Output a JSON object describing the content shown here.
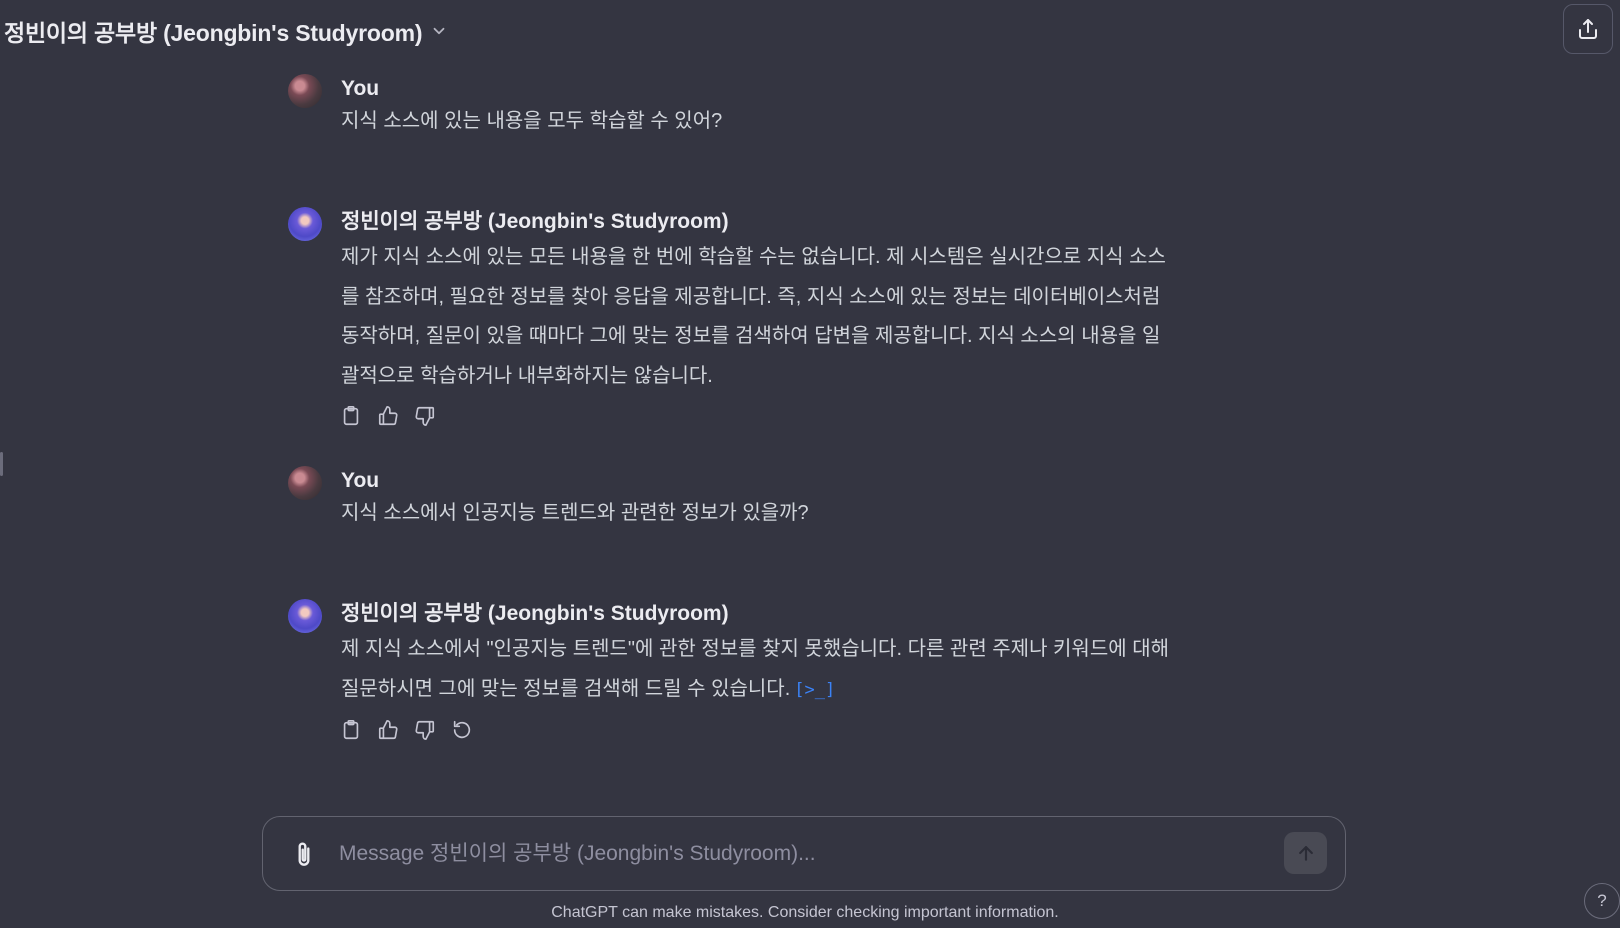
{
  "header": {
    "title": "정빈이의 공부방 (Jeongbin's Studyroom)",
    "dropdown_icon": "chevron-down-icon",
    "share_icon": "share-icon"
  },
  "messages": [
    {
      "author": "You",
      "role": "user",
      "text": "지식 소스에 있는 내용을 모두 학습할 수 있어?"
    },
    {
      "author": "정빈이의 공부방 (Jeongbin's Studyroom)",
      "role": "assistant",
      "lines": [
        "제가 지식 소스에 있는 모든 내용을 한 번에 학습할 수는 없습니다. 제 시스템은 실시간으로 지식 소스",
        "를 참조하며, 필요한 정보를 찾아 응답을 제공합니다. 즉, 지식 소스에 있는 정보는 데이터베이스처럼",
        "동작하며, 질문이 있을 때마다 그에 맞는 정보를 검색하여 답변을 제공합니다. 지식 소스의 내용을 일",
        "괄적으로 학습하거나 내부화하지는 않습니다."
      ]
    },
    {
      "author": "You",
      "role": "user",
      "text": "지식 소스에서 인공지능 트렌드와 관련한 정보가 있을까?"
    },
    {
      "author": "정빈이의 공부방 (Jeongbin's Studyroom)",
      "role": "assistant",
      "lines": [
        "제 지식 소스에서 \"인공지능 트렌드\"에 관한 정보를 찾지 못했습니다. 다른 관련 주제나 키워드에 대해",
        "질문하시면 그에 맞는 정보를 검색해 드릴 수 있습니다."
      ],
      "citation": "[>_]"
    }
  ],
  "composer": {
    "placeholder": "Message 정빈이의 공부방 (Jeongbin's Studyroom)...",
    "value": ""
  },
  "footer": {
    "disclaimer": "ChatGPT can make mistakes. Consider checking important information.",
    "help": "?"
  }
}
